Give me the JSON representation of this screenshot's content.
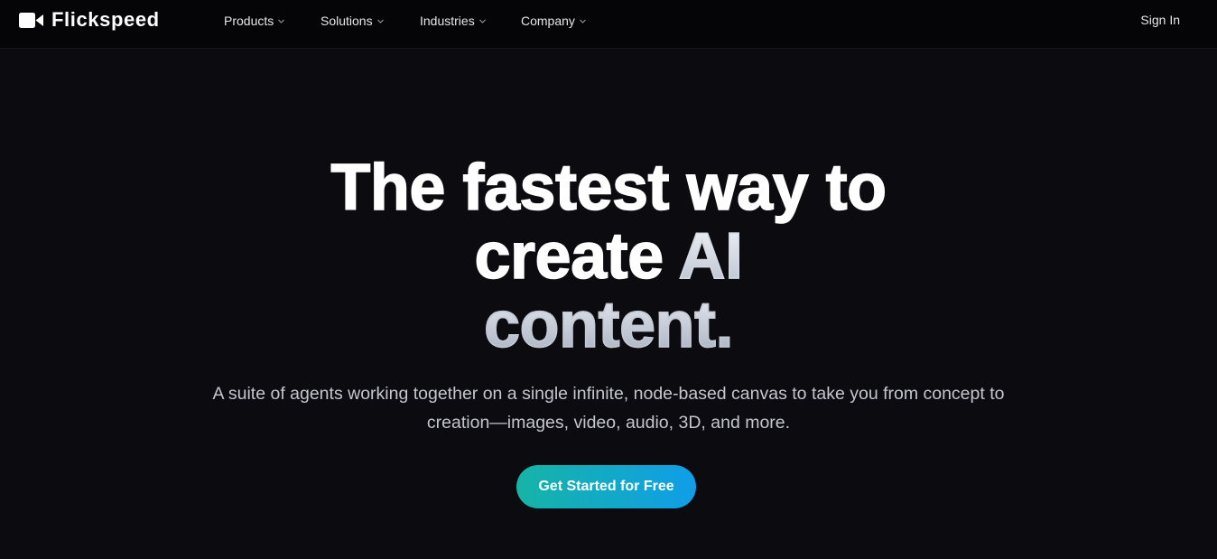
{
  "brand": {
    "name": "Flickspeed",
    "icon": "video-camera-icon"
  },
  "nav": {
    "items": [
      {
        "label": "Products"
      },
      {
        "label": "Solutions"
      },
      {
        "label": "Industries"
      },
      {
        "label": "Company"
      }
    ],
    "signin_label": "Sign In"
  },
  "hero": {
    "title_line1": "The fastest way to",
    "title_line2_plain": "create",
    "title_line2_accent": "AI",
    "title_line3": "content.",
    "subtitle": "A suite of agents working together on a single infinite, node-based canvas to take you from concept to creation—images, video, audio, 3D, and more.",
    "cta_label": "Get Started for Free"
  },
  "colors": {
    "background": "#0c0b10",
    "navbar": "#050507",
    "cta_gradient_start": "#16b4a6",
    "cta_gradient_end": "#0f9ee8",
    "accent_text_top": "#f2f4f8",
    "accent_text_bottom": "#a7afbf"
  }
}
